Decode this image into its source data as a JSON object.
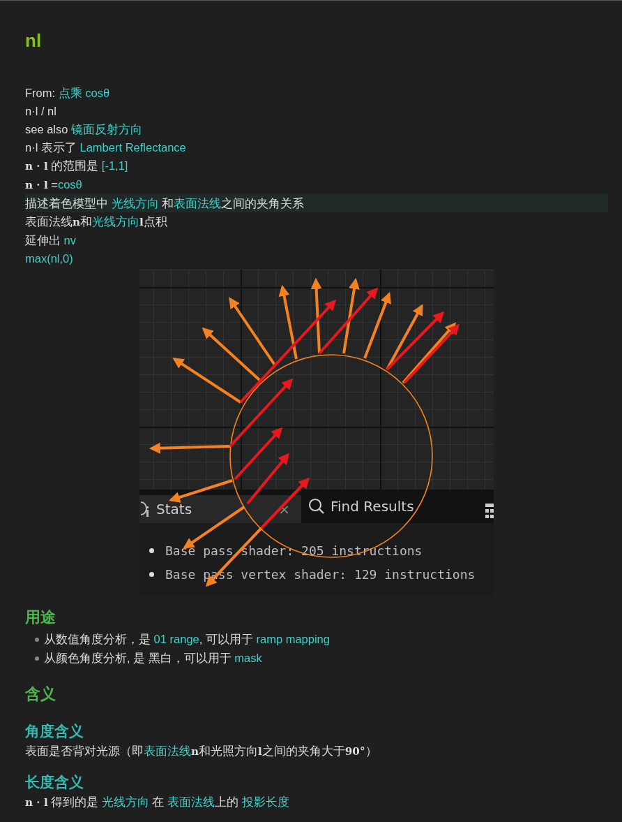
{
  "title": "nl",
  "lines": [
    {
      "highlighted": false,
      "parts": [
        {
          "kind": "plain",
          "text": "From: "
        },
        {
          "kind": "link",
          "text": "点乘 cosθ"
        }
      ]
    },
    {
      "highlighted": false,
      "parts": [
        {
          "kind": "plain",
          "text": "n·l / nl"
        }
      ]
    },
    {
      "highlighted": false,
      "parts": [
        {
          "kind": "plain",
          "text": "see also "
        },
        {
          "kind": "link",
          "text": "镜面反射方向"
        }
      ]
    },
    {
      "highlighted": false,
      "parts": [
        {
          "kind": "plain",
          "text": "n·l 表示了 "
        },
        {
          "kind": "link",
          "text": "Lambert Reflectance"
        }
      ]
    },
    {
      "highlighted": false,
      "parts": [
        {
          "kind": "math",
          "text": "n · l"
        },
        {
          "kind": "plain",
          "text": " 的范围是 "
        },
        {
          "kind": "link",
          "text": "[-1,1]"
        }
      ]
    },
    {
      "highlighted": false,
      "parts": [
        {
          "kind": "math",
          "text": "n · l"
        },
        {
          "kind": "plain",
          "text": " ="
        },
        {
          "kind": "link",
          "text": "cosθ"
        }
      ]
    },
    {
      "highlighted": true,
      "parts": [
        {
          "kind": "plain",
          "text": "描述着色模型中 "
        },
        {
          "kind": "link",
          "text": "光线方向"
        },
        {
          "kind": "plain",
          "text": " 和"
        },
        {
          "kind": "link",
          "text": "表面法线"
        },
        {
          "kind": "plain",
          "text": "之间的夹角关系"
        }
      ]
    },
    {
      "highlighted": false,
      "parts": [
        {
          "kind": "plain",
          "text": "表面法线"
        },
        {
          "kind": "math",
          "text": "n"
        },
        {
          "kind": "plain",
          "text": "和"
        },
        {
          "kind": "link",
          "text": "光线方向"
        },
        {
          "kind": "math",
          "text": "l"
        },
        {
          "kind": "plain",
          "text": "点积"
        }
      ]
    },
    {
      "highlighted": false,
      "parts": [
        {
          "kind": "plain",
          "text": "延伸出 "
        },
        {
          "kind": "link",
          "text": "nv"
        }
      ]
    },
    {
      "highlighted": false,
      "parts": [
        {
          "kind": "link",
          "text": "max(nl,0)"
        }
      ]
    }
  ],
  "figure": {
    "tabs": [
      {
        "label": "Stats",
        "selected": true,
        "close": "×"
      },
      {
        "label": "Find Results",
        "selected": false
      }
    ],
    "stats": [
      "Base pass shader: 205 instructions",
      "Base pass vertex shader: 129 instructions"
    ]
  },
  "usage": {
    "heading": "用途",
    "bullets": [
      [
        {
          "kind": "plain",
          "text": "从数值角度分析，是 "
        },
        {
          "kind": "link",
          "text": "01 range"
        },
        {
          "kind": "plain",
          "text": ", 可以用于 "
        },
        {
          "kind": "link",
          "text": "ramp mapping"
        }
      ],
      [
        {
          "kind": "plain",
          "text": "从颜色角度分析, 是 黑白，可以用于 "
        },
        {
          "kind": "link",
          "text": "mask"
        }
      ]
    ]
  },
  "meaning": {
    "heading": "含义",
    "subsections": [
      {
        "heading": "角度含义",
        "parts": [
          {
            "kind": "plain",
            "text": "表面是否背对光源（即"
          },
          {
            "kind": "link",
            "text": "表面法线"
          },
          {
            "kind": "math",
            "text": "n"
          },
          {
            "kind": "plain",
            "text": "和光照方向"
          },
          {
            "kind": "math",
            "text": "l"
          },
          {
            "kind": "plain",
            "text": "之间的夹角大于"
          },
          {
            "kind": "math",
            "text": "90°"
          },
          {
            "kind": "plain",
            "text": "）"
          }
        ]
      },
      {
        "heading": "长度含义",
        "parts": [
          {
            "kind": "math",
            "text": "n · l"
          },
          {
            "kind": "plain",
            "text": " 得到的是 "
          },
          {
            "kind": "link",
            "text": "光线方向"
          },
          {
            "kind": "plain",
            "text": " 在 "
          },
          {
            "kind": "link",
            "text": "表面法线"
          },
          {
            "kind": "plain",
            "text": "上的 "
          },
          {
            "kind": "link",
            "text": "投影长度"
          }
        ]
      }
    ]
  }
}
